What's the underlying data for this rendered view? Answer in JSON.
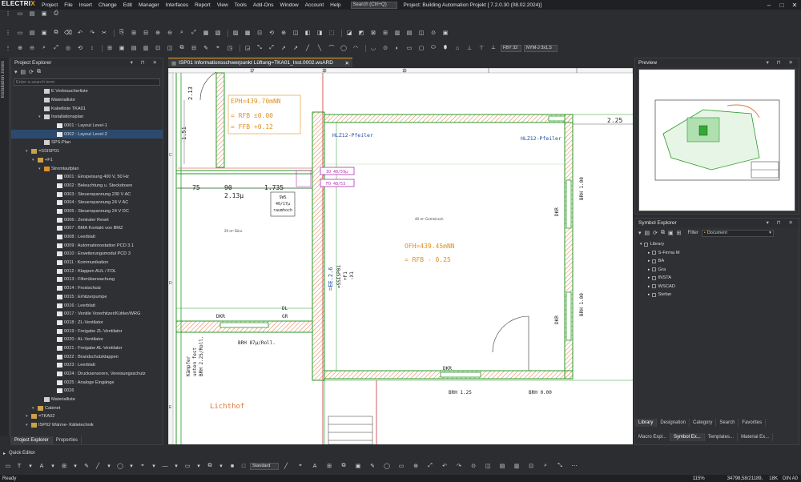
{
  "app": {
    "logo_main": "ELECTRI",
    "logo_x": "X",
    "title": "Project: Building Automation Projekt  [ 7.2.0.30 (08.02.2024)]"
  },
  "menu": [
    "Project",
    "File",
    "Insert",
    "Change",
    "Edit",
    "Manager",
    "Interfaces",
    "Report",
    "View",
    "Tools",
    "Add-Ons",
    "Window",
    "Account",
    "Help"
  ],
  "search": {
    "placeholder": "Search (Ctrl+Q)"
  },
  "window_controls": [
    "–",
    "□",
    "✕"
  ],
  "toolbar2": {
    "combo1": "FBY 32",
    "combo2": "NYM-J 3x1,5"
  },
  "left_strip": {
    "label": "Installation zones"
  },
  "project_explorer": {
    "title": "Project Explorer",
    "search_placeholder": "Enter a search term",
    "items": [
      {
        "label": "E Verbraucherliste",
        "indent": 4,
        "icon": "doc"
      },
      {
        "label": "Materialliste",
        "indent": 4,
        "icon": "doc"
      },
      {
        "label": "Kabelliste TKA01",
        "indent": 4,
        "icon": "doc"
      },
      {
        "label": "Installationsplan",
        "indent": 4,
        "icon": "doc"
      },
      {
        "label": "0001 : Layout Level-1",
        "indent": 6,
        "icon": "page"
      },
      {
        "label": "0002 : Layout Level-2",
        "indent": 6,
        "icon": "page",
        "selected": true
      },
      {
        "label": "SPS-Plan",
        "indent": 4,
        "icon": "doc"
      },
      {
        "label": "=SSISP01",
        "indent": 2,
        "icon": "folder"
      },
      {
        "label": "+F1",
        "indent": 3,
        "icon": "folder"
      },
      {
        "label": "Stromlaufplan",
        "indent": 4,
        "icon": "orange"
      },
      {
        "label": "0001 : Einspeisung 400 V, 50 Hz",
        "indent": 6,
        "icon": "page"
      },
      {
        "label": "0002 : Beleuchtung u. Steckdosen",
        "indent": 6,
        "icon": "page"
      },
      {
        "label": "0003 : Steuerspannung 230 V AC",
        "indent": 6,
        "icon": "page"
      },
      {
        "label": "0004 : Steuerspannung 24 V AC",
        "indent": 6,
        "icon": "page"
      },
      {
        "label": "0005 : Steuerspannung 24 V DC",
        "indent": 6,
        "icon": "page"
      },
      {
        "label": "0006 : Zentraler Reset",
        "indent": 6,
        "icon": "page"
      },
      {
        "label": "0007 : BMA Kontakt von BMZ",
        "indent": 6,
        "icon": "page"
      },
      {
        "label": "0008 : Leerblatt",
        "indent": 6,
        "icon": "page"
      },
      {
        "label": "0009 : Automationsstation PCD 3.1",
        "indent": 6,
        "icon": "page"
      },
      {
        "label": "0010 : Erweiterungsmodul PCD 3",
        "indent": 6,
        "icon": "page"
      },
      {
        "label": "0011 : Kommunikation",
        "indent": 6,
        "icon": "page"
      },
      {
        "label": "0012 : Klappen AUL / FOL",
        "indent": 6,
        "icon": "page"
      },
      {
        "label": "0013 : Filterüberwachung",
        "indent": 6,
        "icon": "page"
      },
      {
        "label": "0014 : Frostschutz",
        "indent": 6,
        "icon": "page"
      },
      {
        "label": "0015 : Erhitzerpumpe",
        "indent": 6,
        "icon": "page"
      },
      {
        "label": "0016 : Leerblatt",
        "indent": 6,
        "icon": "page"
      },
      {
        "label": "0017 : Ventile Vorerhitzer/Kühler/WRG",
        "indent": 6,
        "icon": "page"
      },
      {
        "label": "0018 : ZL-Ventilator",
        "indent": 6,
        "icon": "page"
      },
      {
        "label": "0019 : Freigabe ZL-Ventilator",
        "indent": 6,
        "icon": "page"
      },
      {
        "label": "0020 : AL-Ventilator",
        "indent": 6,
        "icon": "page"
      },
      {
        "label": "0021 : Freigabe AL-Ventilator",
        "indent": 6,
        "icon": "page"
      },
      {
        "label": "0022 : Brandschutzklappen",
        "indent": 6,
        "icon": "page"
      },
      {
        "label": "0023 : Leerblatt",
        "indent": 6,
        "icon": "page"
      },
      {
        "label": "0024 : Drucksensoren, Vereisungsschutz",
        "indent": 6,
        "icon": "page"
      },
      {
        "label": "0025 : Analoge Eingänge",
        "indent": 6,
        "icon": "page"
      },
      {
        "label": "0026",
        "indent": 6,
        "icon": "page"
      },
      {
        "label": "Materialliste",
        "indent": 4,
        "icon": "doc"
      },
      {
        "label": "Cabinet",
        "indent": 3,
        "icon": "folder"
      },
      {
        "label": "=TKA02",
        "indent": 2,
        "icon": "folder"
      },
      {
        "label": "ISP02 Wärme- Kältetechnik",
        "indent": 2,
        "icon": "folder"
      }
    ],
    "tabs": [
      "Project Explorer",
      "Properties"
    ]
  },
  "document_tab": {
    "label": "ISP01 Informationsschwerpunkt Lüftung=TKA01_Inst.0002.wsARD"
  },
  "drawing": {
    "ruler_top": [
      "17",
      "18",
      "19"
    ],
    "ruler_left": [
      "C",
      "D",
      "E"
    ],
    "labels": {
      "eph": "EPH=439.70mNN",
      "rfb1": "= RFB ±0.00",
      "ffb": "= FFB +0.12",
      "d1": "1.51",
      "d2": "2.13",
      "d3": "75",
      "d4": "90",
      "d5": "1.735",
      "d6": "2.13µ",
      "d7": "2.25",
      "sws": "SWS\n40/17µ\nraumhoch",
      "ren": "IO 48/59µ",
      "ren2": "FO 48/53",
      "pfeiler1": "HLZ12-Pfeiler",
      "pfeiler2": "HLZ12-Pfeiler",
      "ofh": "OFH=439.45mNN",
      "rfb2": "= RFB - 0.25",
      "room1": "29 m² Büro",
      "room2": "40 m² Gemeinsch",
      "hhv": "=EE.2.6",
      "ssisp": "=SSISP01\n+F1\n-X1",
      "dkr1": "DKR",
      "dkr2": "DKR",
      "dkr3": "DKR",
      "dkr4": "DKR",
      "dl": "DL",
      "gr": "GR",
      "brh1": "BRH 87µ/Roll.",
      "brh2": "BRH 1.25",
      "brh3": "BRH 0.00",
      "brh4": "BRH 1.00",
      "brh5": "BRH 1.00",
      "kaepfer": "Kämpfer\nunten fest\nBRH 2.25/Roll.",
      "lichthof": "Lichthof"
    }
  },
  "preview": {
    "title": "Preview"
  },
  "symbol_explorer": {
    "title": "Symbol Explorer",
    "filter_label": "Filter",
    "filter_value": "Document",
    "items": [
      {
        "label": "Library",
        "indent": 0
      },
      {
        "label": "S-Firma M",
        "indent": 1
      },
      {
        "label": "BA",
        "indent": 1
      },
      {
        "label": "Gra",
        "indent": 1
      },
      {
        "label": "INSTA",
        "indent": 1
      },
      {
        "label": "WSCAD",
        "indent": 1
      },
      {
        "label": "Stefan",
        "indent": 1
      }
    ],
    "tabs": [
      "Library",
      "Designation",
      "Category",
      "Search",
      "Favorites"
    ],
    "bottom_tabs": [
      "Macro Expl...",
      "Symbol Ex...",
      "Templates...",
      "Material Ex..."
    ]
  },
  "quick_editor": {
    "label": "Quick Editor"
  },
  "bottom_toolbar": {
    "combo": "Standard"
  },
  "status": {
    "left": "Ready",
    "zoom": "115%",
    "coords": "34798,58/21189,",
    "size": "18K",
    "format": "DIN A0"
  }
}
